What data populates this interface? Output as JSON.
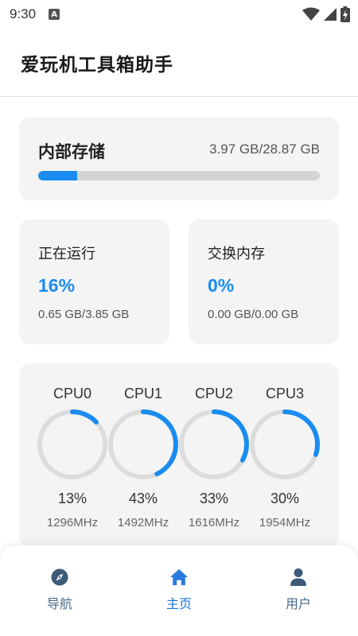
{
  "status_bar": {
    "time": "9:30",
    "notification_icon": "a-icon",
    "icons": [
      "wifi-icon",
      "signal-icon",
      "battery-icon"
    ]
  },
  "app_bar": {
    "title": "爱玩机工具箱助手"
  },
  "storage": {
    "title": "内部存储",
    "value": "3.97 GB/28.87 GB",
    "used_fraction": 0.1375
  },
  "memory": [
    {
      "title": "正在运行",
      "percent": "16%",
      "detail": "0.65 GB/3.85 GB"
    },
    {
      "title": "交换内存",
      "percent": "0%",
      "detail": "0.00 GB/0.00 GB"
    }
  ],
  "cpus": [
    {
      "name": "CPU0",
      "percent": "13%",
      "load": 0.13,
      "freq": "1296MHz"
    },
    {
      "name": "CPU1",
      "percent": "43%",
      "load": 0.43,
      "freq": "1492MHz"
    },
    {
      "name": "CPU2",
      "percent": "33%",
      "load": 0.33,
      "freq": "1616MHz"
    },
    {
      "name": "CPU3",
      "percent": "30%",
      "load": 0.3,
      "freq": "1954MHz"
    }
  ],
  "bottom_nav": {
    "items": [
      {
        "label": "导航",
        "icon": "compass-icon",
        "active": false
      },
      {
        "label": "主页",
        "icon": "home-icon",
        "active": true
      },
      {
        "label": "用户",
        "icon": "user-icon",
        "active": false
      }
    ]
  },
  "colors": {
    "accent": "#1a8cf0",
    "track": "#dcdcdc",
    "card_bg": "#f4f4f4",
    "nav_active": "#1a73d8",
    "nav_inactive": "#4a6a8a"
  }
}
